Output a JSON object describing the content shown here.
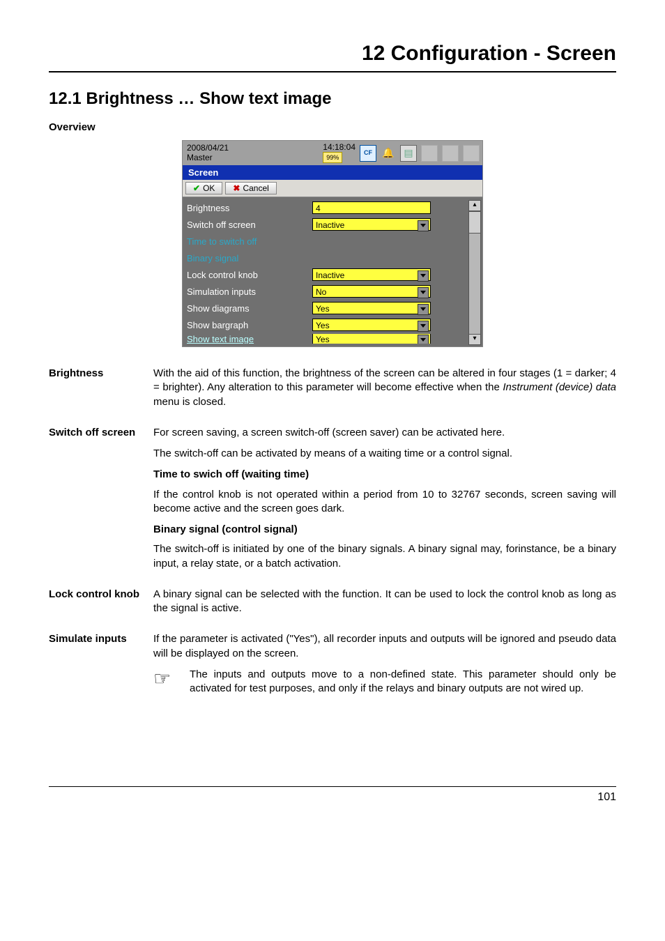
{
  "chapter_title": "12 Configuration - Screen",
  "section_title": "12.1   Brightness …  Show text image",
  "overview_label": "Overview",
  "ui": {
    "header": {
      "date": "2008/04/21",
      "time": "14:18:04",
      "master": "Master",
      "cf_label": "CF",
      "pct": "99%"
    },
    "title": "Screen",
    "ok_label": "OK",
    "cancel_label": "Cancel",
    "rows": {
      "brightness": {
        "label": "Brightness",
        "value": "4"
      },
      "switch_off": {
        "label": "Switch off screen",
        "value": "Inactive"
      },
      "time_to_switch": {
        "label": "Time to switch off"
      },
      "binary_signal": {
        "label": "Binary signal"
      },
      "lock_knob": {
        "label": "Lock control knob",
        "value": "Inactive"
      },
      "simulation": {
        "label": "Simulation inputs",
        "value": "No"
      },
      "show_diagrams": {
        "label": "Show diagrams",
        "value": "Yes"
      },
      "show_bargraph": {
        "label": "Show bargraph",
        "value": "Yes"
      },
      "show_text_image": {
        "label": "Show text image",
        "value": "Yes"
      }
    }
  },
  "sections": {
    "brightness": {
      "side": "Brightness",
      "p1a": "With the aid of this function, the brightness of the screen can be altered in four stages (1 = darker; 4 = brighter). Any alteration to this parameter will become effective when the ",
      "p1_ital": "Instrument (device) data",
      "p1b": " menu is closed."
    },
    "switch_off": {
      "side": "Switch off screen",
      "p1": "For screen saving, a screen switch-off (screen saver) can be activated here.",
      "p2": "The switch-off can be activated by means of a waiting time or a control signal.",
      "sub1": "Time to swich off (waiting time)",
      "p3": "If the control knob is not operated within a period from 10 to 32767 seconds, screen saving will become active and the screen goes dark.",
      "sub2": "Binary signal (control signal)",
      "p4": "The switch-off is initiated by one of the binary signals. A binary signal may, forinstance, be a binary input, a relay state, or a batch activation."
    },
    "lock_knob": {
      "side": "Lock control knob",
      "p1": "A binary signal can be selected with the function. It can be used to lock the control knob as long as the signal is active."
    },
    "simulate": {
      "side": "Simulate inputs",
      "p1": "If the parameter is activated (\"Yes\"), all recorder inputs and outputs will be ignored and pseudo data will be displayed on the screen.",
      "note": "The inputs and outputs move to a non-defined state. This parameter should only be activated for test purposes, and only if the relays and binary outputs are not wired up."
    }
  },
  "page_number": "101"
}
